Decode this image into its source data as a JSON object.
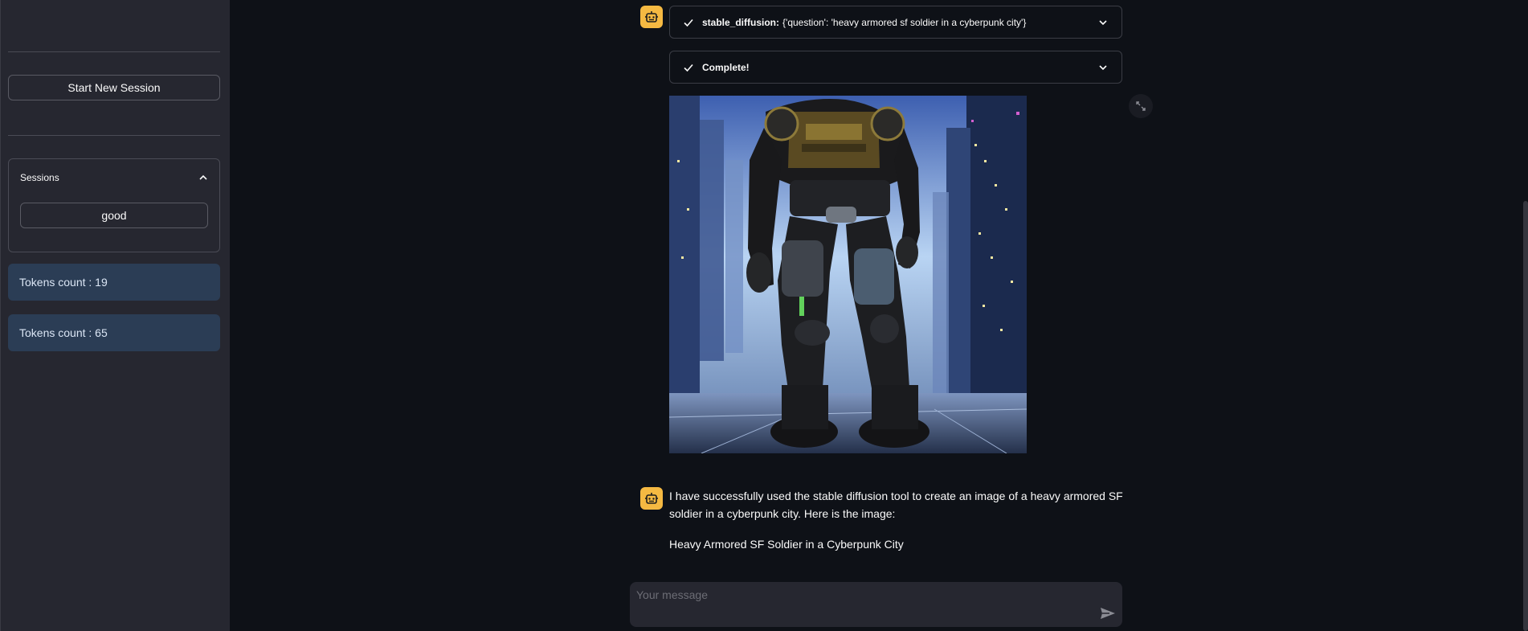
{
  "sidebar": {
    "start_button": "Start New Session",
    "sessions_title": "Sessions",
    "sessions": [
      "good"
    ],
    "token_counts": [
      "Tokens count : 19",
      "Tokens count : 65"
    ]
  },
  "chat": {
    "tool_call": {
      "name": "stable_diffusion:",
      "args": "{'question': 'heavy armored sf soldier in a cyberpunk city'}"
    },
    "status": "Complete!",
    "image_icon": "generated-image-cyberpunk-soldier",
    "response": "I have successfully used the stable diffusion tool to create an image of a heavy armored SF soldier in a cyberpunk city. Here is the image:",
    "caption": "Heavy Armored SF Soldier in a Cyberpunk City",
    "input_placeholder": "Your message"
  },
  "colors": {
    "background": "#0e1117",
    "sidebar": "#262730",
    "token_box": "#2b3d55",
    "avatar": "#f5b942"
  },
  "icons": [
    "check-icon",
    "chevron-down-icon",
    "chevron-up-icon",
    "robot-icon",
    "fullscreen-icon",
    "send-icon"
  ]
}
